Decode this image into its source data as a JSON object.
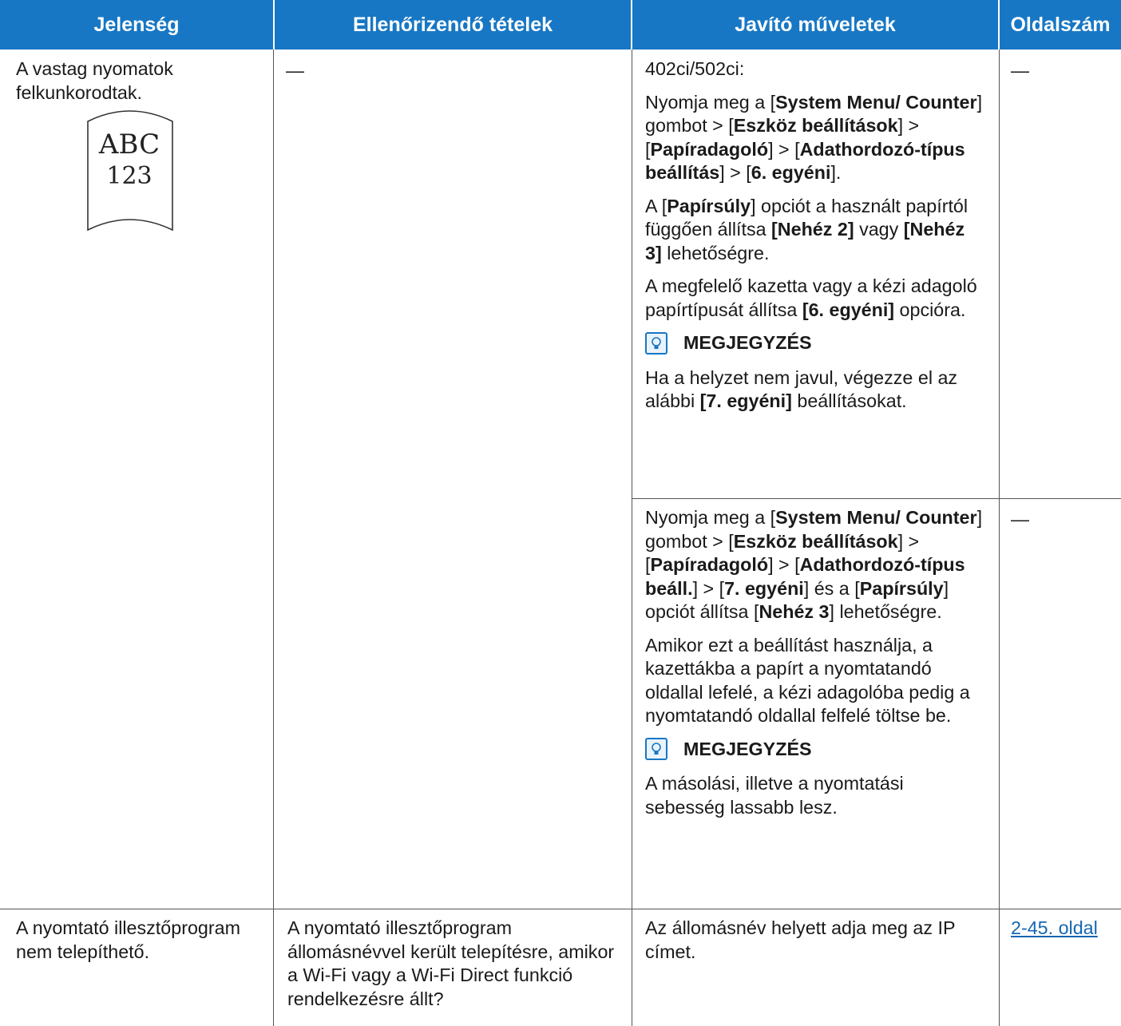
{
  "header": {
    "col1": "Jelenség",
    "col2": "Ellenőrizendő tételek",
    "col3": "Javító műveletek",
    "col4": "Oldalszám"
  },
  "row1": {
    "symptom": "A vastag nyomatok felkunkorodtak.",
    "illustration_line1": "ABC",
    "illustration_line2": "123",
    "check": "—",
    "action_a": {
      "model": "402ci/502ci:",
      "p1": {
        "t1": "Nyomja meg a [",
        "b1": "System Menu/ Counter",
        "t2": "] gombot > [",
        "b2": "Eszköz beállítások",
        "t3": "] > [",
        "b3": "Papíradagoló",
        "t4": "] > [",
        "b4": "Adathordozó-típus beállítás",
        "t5": "] > [",
        "b5": "6. egyéni",
        "t6": "]."
      },
      "p2": {
        "t1": "A [",
        "b1": "Papírsúly",
        "t2": "] opciót a használt papírtól függően állítsa ",
        "b2": "[Nehéz 2]",
        "t3": " vagy ",
        "b3": "[Nehéz 3]",
        "t4": " lehetőségre."
      },
      "p3": {
        "t1": "A megfelelő kazetta vagy a kézi adagoló papírtípusát állítsa ",
        "b1": "[6. egyéni]",
        "t2": " opcióra."
      },
      "note_label": "MEGJEGYZÉS",
      "note": {
        "t1": "Ha a helyzet nem javul, végezze el az alábbi ",
        "b1": "[7. egyéni]",
        "t2": " beállításokat."
      },
      "page": "—"
    },
    "action_b": {
      "p1": {
        "t1": "Nyomja meg a [",
        "b1": "System Menu/ Counter",
        "t2": "] gombot > [",
        "b2": "Eszköz beállítások",
        "t3": "] > [",
        "b3": "Papíradagoló",
        "t4": "] > [",
        "b4": "Adathordozó-típus beáll.",
        "t5": "] > [",
        "b5": "7. egyéni",
        "t6": "] és a [",
        "b6": "Papírsúly",
        "t7": "] opciót állítsa [",
        "b7": "Nehéz 3",
        "t8": "] lehetőségre."
      },
      "p2": "Amikor ezt a beállítást használja, a kazettákba a papírt a nyomtatandó oldallal lefelé, a kézi adagolóba pedig a nyomtatandó oldallal felfelé töltse be.",
      "note_label": "MEGJEGYZÉS",
      "note": "A másolási, illetve a nyomtatási sebesség lassabb lesz.",
      "page": "—"
    }
  },
  "row2": {
    "symptom": "A nyomtató illesztőprogram nem telepíthető.",
    "check": "A nyomtató illesztőprogram állomásnévvel került telepítésre, amikor a Wi-Fi vagy a Wi-Fi Direct funkció rendelkezésre állt?",
    "action": "Az állomásnév helyett adja meg az IP címet.",
    "page_link": "2-45. oldal"
  },
  "colors": {
    "header_bg": "#1777c4",
    "rule": "#555555",
    "link": "#1567b0"
  }
}
